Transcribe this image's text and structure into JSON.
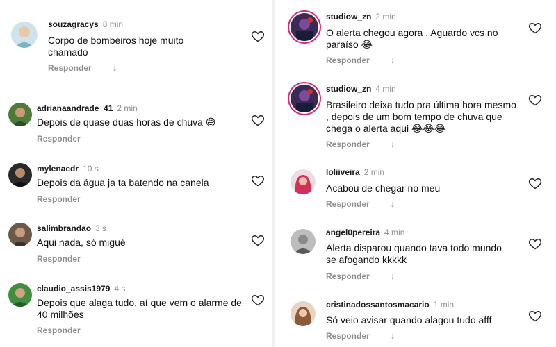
{
  "reply_label": "Responder",
  "left_comments": [
    {
      "username": "souzagracys",
      "time": "8 min",
      "text": "Corpo de bombeiros hoje muito chamado"
    },
    {
      "username": "adrianaandrade_41",
      "time": "2 min",
      "text": "Depois de quase duas horas de chuva 😅"
    },
    {
      "username": "mylenacdr",
      "time": "10 s",
      "text": "Depois da água ja ta batendo na canela"
    },
    {
      "username": "salimbrandao",
      "time": "3 s",
      "text": "Aqui nada, só migué"
    },
    {
      "username": "claudio_assis1979",
      "time": "4 s",
      "text": "Depois que alaga tudo, aí que vem o alarme de 40 milhões"
    }
  ],
  "right_comments": [
    {
      "username": "studiow_zn",
      "time": "2 min",
      "text": "O alerta chegou agora . Aguardo vcs no paraíso 😂"
    },
    {
      "username": "studiow_zn",
      "time": "4 min",
      "text": "Brasileiro deixa tudo pra última hora mesmo , depois de um bom tempo de chuva que chega o alerta aqui 😂😂😂"
    },
    {
      "username": "loliiveira",
      "time": "2 min",
      "text": "Acabou de chegar no meu"
    },
    {
      "username": "angel0pereira",
      "time": "4 min",
      "text": "Alerta disparou quando tava todo mundo se afogando kkkkk"
    },
    {
      "username": "cristinadossantosmacario",
      "time": "1 min",
      "text": "Só veio avisar quando alagou tudo afff"
    }
  ],
  "icons": {
    "like": "heart-outline-icon",
    "reply_arrow": "arrow-down-icon"
  },
  "colors": {
    "story_ring": "#d62976",
    "muted": "#8e8e8e"
  }
}
